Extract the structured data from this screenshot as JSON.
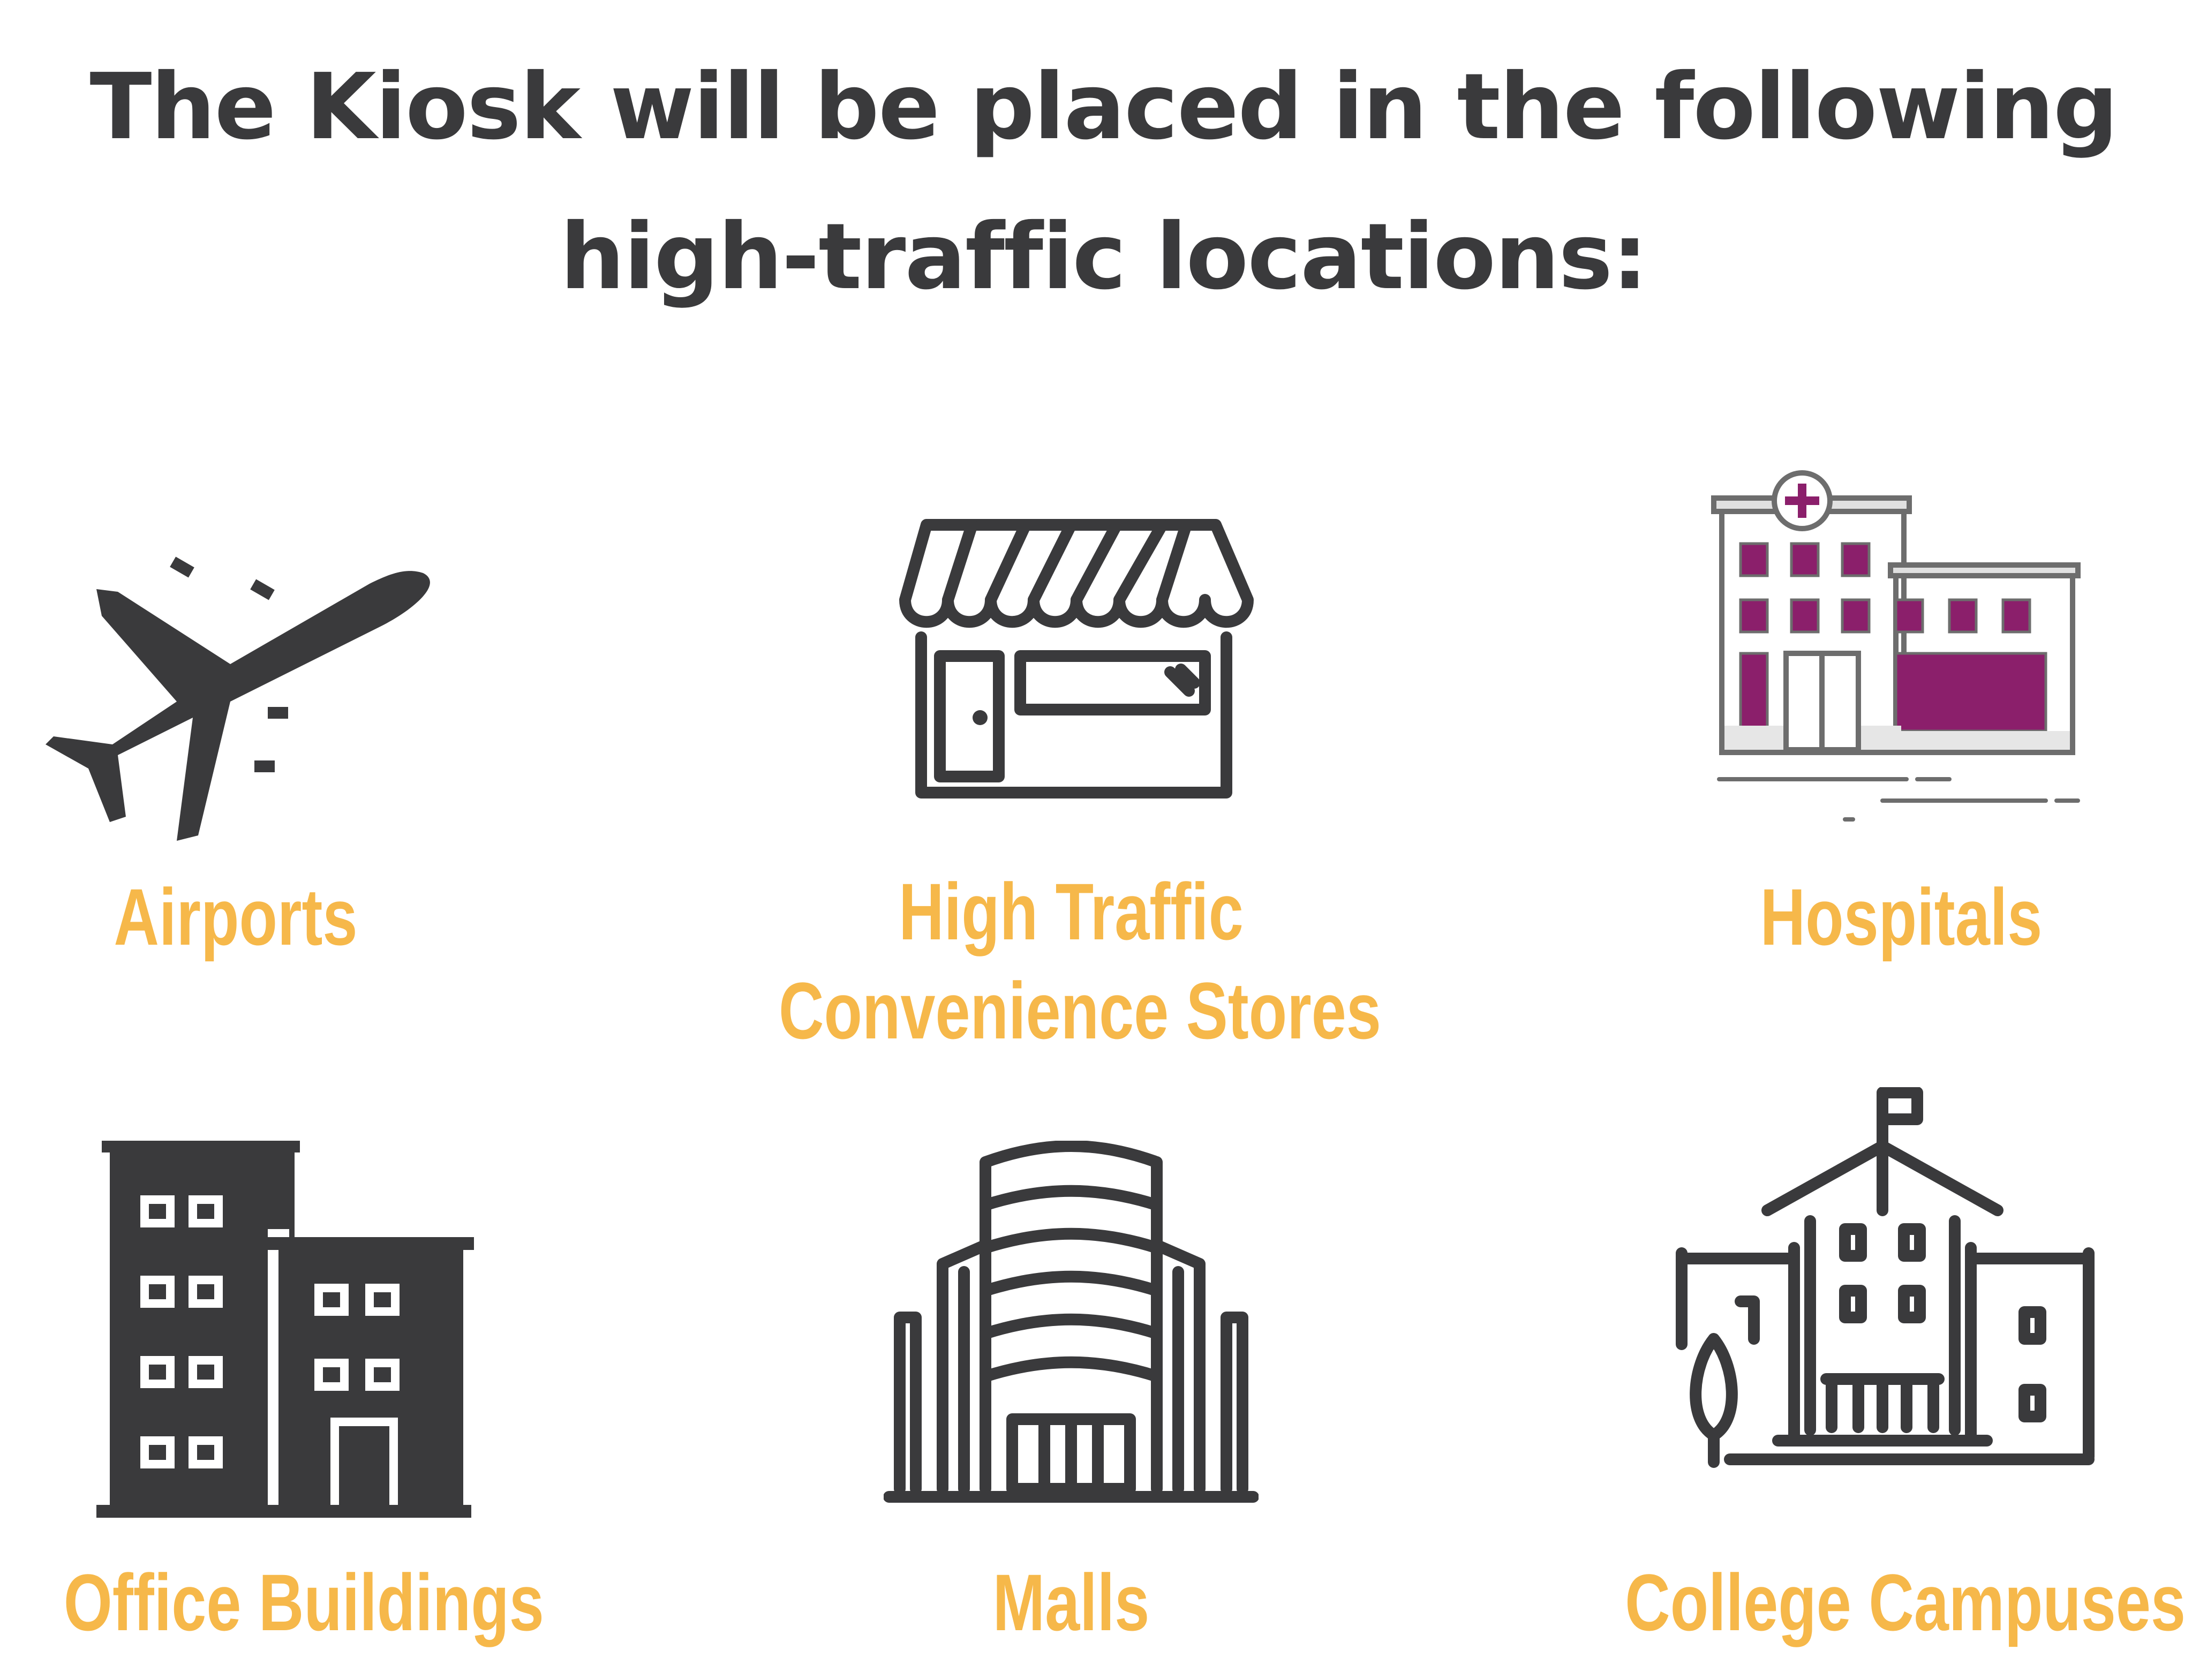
{
  "title": {
    "line1": "The Kiosk will be placed in the following",
    "line2": "high-traffic locations:"
  },
  "colors": {
    "title": "#3a3a3c",
    "label": "#f6b84a",
    "icon": "#3a3a3c",
    "hospital_accent": "#8b1f6b"
  },
  "locations": [
    {
      "label_lines": [
        "Airports"
      ],
      "icon": "airplane-icon"
    },
    {
      "label_lines": [
        "High Traffic",
        "Convenience Stores"
      ],
      "icon": "storefront-icon"
    },
    {
      "label_lines": [
        "Hospitals"
      ],
      "icon": "hospital-icon"
    },
    {
      "label_lines": [
        "Office Buildings"
      ],
      "icon": "office-building-icon"
    },
    {
      "label_lines": [
        "Malls"
      ],
      "icon": "mall-icon"
    },
    {
      "label_lines": [
        "College Campuses"
      ],
      "icon": "college-campus-icon"
    }
  ]
}
